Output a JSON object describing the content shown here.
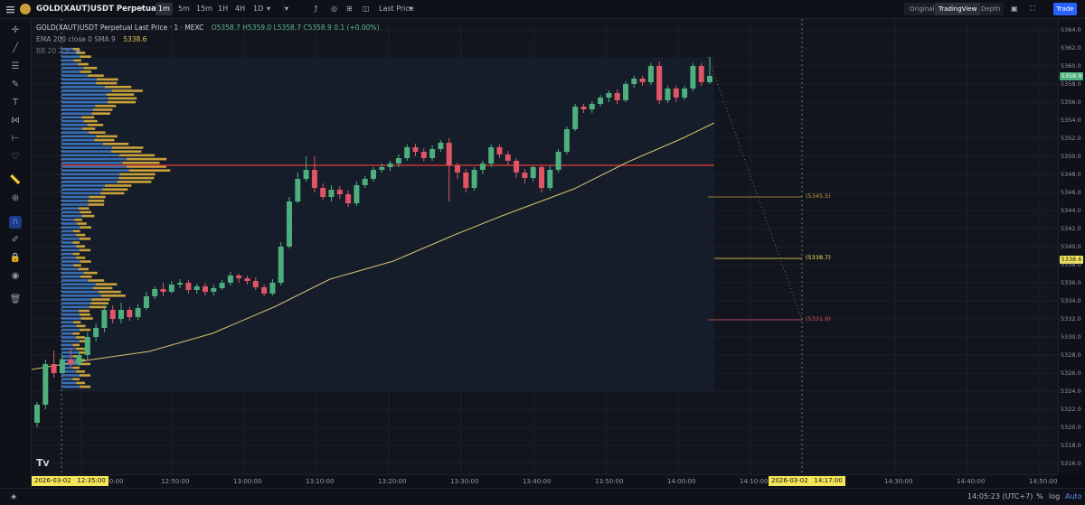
{
  "symbol": {
    "name": "GOLD(XAUT)USDT Perpetual"
  },
  "timeframes": [
    "1m",
    "5m",
    "15m",
    "1H",
    "4H",
    "1D"
  ],
  "active_timeframe": "1m",
  "price_type": "Last Price",
  "view_modes": [
    "Original",
    "TradingView",
    "Depth"
  ],
  "active_view_mode": "TradingView",
  "trade_label": "Trade",
  "legend": {
    "title": "GOLD(XAUT)USDT Perpetual Last Price · 1 · MEXC",
    "ohlc": "O5358.7 H5359.0 L5358.7 C5358.9 0.1 (+0.00%)",
    "ema_label": "EMA 200 close 0 SMA 9",
    "ema_value": "5338.6",
    "bb_label": "BB 20 2 S"
  },
  "y_axis": {
    "ticks": [
      "5364.0",
      "5362.0",
      "5360.0",
      "5358.0",
      "5356.0",
      "5354.0",
      "5352.0",
      "5350.0",
      "5348.0",
      "5346.0",
      "5344.0",
      "5342.0",
      "5340.0",
      "5338.0",
      "5336.0",
      "5334.0",
      "5332.0",
      "5330.0",
      "5328.0",
      "5326.0",
      "5324.0",
      "5322.0",
      "5320.0",
      "5318.0",
      "5316.0"
    ],
    "current_price_tag": "5358.9",
    "ema_tag": "5338.6"
  },
  "x_axis": {
    "ticks": [
      "12:40:00",
      "12:50:00",
      "13:00:00",
      "13:10:00",
      "13:20:00",
      "13:30:00",
      "13:40:00",
      "13:50:00",
      "14:00:00",
      "14:10:00",
      "14:30:00",
      "14:40:00",
      "14:50:00"
    ],
    "crosshair_left_date": "2026-03-02",
    "crosshair_left_time": "12:35:00",
    "crosshair_right_date": "2026-03-02",
    "crosshair_right_time": "14:17:00"
  },
  "levels": {
    "upper": "(5345.5)",
    "middle": "(5338.7)",
    "lower": "(5331.9)"
  },
  "bottom": {
    "time": "14:05:23 (UTC+7)",
    "percent_label": "%",
    "log_label": "log",
    "auto_label": "Auto"
  },
  "colors": {
    "up": "#4caf7d",
    "down": "#e05566",
    "ema": "#d4c46a",
    "poc": "#e53935",
    "vp_blue": "#3b6fb5",
    "vp_gold": "#c9a13b"
  },
  "icons": [
    "crosshair-icon",
    "trend-line-icon",
    "horizontal-lines-icon",
    "brush-icon",
    "text-icon",
    "pattern-icon",
    "forecast-icon",
    "heart-icon",
    "ruler-icon",
    "zoom-icon",
    "magnet-icon",
    "lock-drawings-icon",
    "lock-icon",
    "eye-icon",
    "trash-icon"
  ],
  "chart_data": {
    "type": "candlestick",
    "ylim": [
      5315,
      5365
    ],
    "candles": [
      [
        5320.5,
        5322.5,
        5320,
        5322.8
      ],
      [
        5322.5,
        5327,
        5322,
        5327.5
      ],
      [
        5327,
        5326,
        5325.5,
        5328.5
      ],
      [
        5326,
        5327.5,
        5325.8,
        5328
      ],
      [
        5327.5,
        5327,
        5326.5,
        5328.8
      ],
      [
        5327,
        5328,
        5326.8,
        5328.4
      ],
      [
        5328,
        5330,
        5327.5,
        5330.5
      ],
      [
        5330,
        5331,
        5329.5,
        5331.5
      ],
      [
        5331,
        5333,
        5330.5,
        5333.5
      ],
      [
        5333,
        5332,
        5331.5,
        5333.5
      ],
      [
        5332,
        5333,
        5331.5,
        5333.8
      ],
      [
        5333,
        5332.2,
        5331.8,
        5333.3
      ],
      [
        5332.2,
        5333.2,
        5331.9,
        5333.6
      ],
      [
        5333.2,
        5334.5,
        5333,
        5335
      ],
      [
        5334.5,
        5335.3,
        5334.2,
        5335.6
      ],
      [
        5335.3,
        5335,
        5334.5,
        5336
      ],
      [
        5335,
        5335.8,
        5334.8,
        5336.2
      ],
      [
        5335.8,
        5336,
        5335.4,
        5336.4
      ],
      [
        5336,
        5335.2,
        5334.8,
        5336.3
      ],
      [
        5335.2,
        5335.6,
        5334.8,
        5335.9
      ],
      [
        5335.6,
        5335,
        5334.6,
        5336
      ],
      [
        5335,
        5335.4,
        5334.6,
        5335.8
      ],
      [
        5335.4,
        5336,
        5335.2,
        5336.3
      ],
      [
        5336,
        5336.8,
        5335.7,
        5337.2
      ],
      [
        5336.8,
        5336.5,
        5336,
        5337
      ],
      [
        5336.5,
        5336.2,
        5335.8,
        5336.8
      ],
      [
        5336.2,
        5335.5,
        5335.2,
        5336.6
      ],
      [
        5335.5,
        5334.8,
        5334.5,
        5335.8
      ],
      [
        5334.8,
        5336,
        5334.6,
        5336.4
      ],
      [
        5336,
        5340,
        5335.7,
        5340.5
      ],
      [
        5340,
        5345,
        5339.8,
        5345.5
      ],
      [
        5345,
        5347.5,
        5344.8,
        5348.2
      ],
      [
        5347.5,
        5348.5,
        5347.2,
        5350
      ],
      [
        5348.5,
        5346.5,
        5346,
        5350
      ],
      [
        5346.5,
        5345.5,
        5345.2,
        5347
      ],
      [
        5345.5,
        5346.3,
        5345,
        5346.8
      ],
      [
        5346.3,
        5345.8,
        5345.3,
        5346.7
      ],
      [
        5345.8,
        5344.8,
        5344.4,
        5346.2
      ],
      [
        5344.8,
        5346.8,
        5344.5,
        5347.2
      ],
      [
        5346.8,
        5347.5,
        5346.5,
        5347.8
      ],
      [
        5347.5,
        5348.5,
        5347.2,
        5348.8
      ],
      [
        5348.5,
        5348.8,
        5348.2,
        5349.2
      ],
      [
        5348.8,
        5349.2,
        5348.4,
        5349.5
      ],
      [
        5349.2,
        5349.8,
        5348.8,
        5350.2
      ],
      [
        5349.8,
        5351,
        5349.5,
        5351.3
      ],
      [
        5351,
        5350.5,
        5350,
        5351.4
      ],
      [
        5350.5,
        5349.8,
        5349.4,
        5350.9
      ],
      [
        5349.8,
        5350.8,
        5349.5,
        5351.2
      ],
      [
        5350.8,
        5351.5,
        5350.5,
        5351.8
      ],
      [
        5351.5,
        5349,
        5345,
        5352
      ],
      [
        5349,
        5348.2,
        5347.5,
        5349.3
      ],
      [
        5348.2,
        5346.5,
        5346,
        5348.6
      ],
      [
        5346.5,
        5348.5,
        5346.2,
        5348.8
      ],
      [
        5348.5,
        5349.2,
        5348,
        5349.5
      ],
      [
        5349.2,
        5351,
        5348.8,
        5351.3
      ],
      [
        5351,
        5350.2,
        5349.8,
        5351.3
      ],
      [
        5350.2,
        5349.5,
        5349,
        5350.6
      ],
      [
        5349.5,
        5348.2,
        5347.6,
        5349.8
      ],
      [
        5348.2,
        5347.6,
        5347,
        5348.6
      ],
      [
        5347.6,
        5348.8,
        5347.2,
        5349
      ],
      [
        5348.8,
        5346.5,
        5346,
        5349
      ],
      [
        5346.5,
        5348.5,
        5346.2,
        5349
      ],
      [
        5348.5,
        5350.5,
        5348.2,
        5350.8
      ],
      [
        5350.5,
        5353,
        5350.2,
        5353.3
      ],
      [
        5353,
        5355.5,
        5352.8,
        5355.8
      ],
      [
        5355.5,
        5355.2,
        5354.8,
        5355.8
      ],
      [
        5355.2,
        5355.8,
        5354.8,
        5356.1
      ],
      [
        5355.8,
        5356.5,
        5355.5,
        5356.8
      ],
      [
        5356.5,
        5357,
        5356,
        5357.3
      ],
      [
        5357,
        5356.2,
        5355.8,
        5357.4
      ],
      [
        5356.2,
        5358,
        5356,
        5358.3
      ],
      [
        5358,
        5358.6,
        5357.6,
        5358.9
      ],
      [
        5358.6,
        5358.2,
        5357.8,
        5358.9
      ],
      [
        5358.2,
        5360,
        5357.9,
        5360.3
      ],
      [
        5360,
        5356.2,
        5355.8,
        5360.5
      ],
      [
        5356.2,
        5357.5,
        5355.9,
        5357.8
      ],
      [
        5357.5,
        5356.5,
        5356,
        5357.8
      ],
      [
        5356.5,
        5357.5,
        5356.2,
        5357.8
      ],
      [
        5357.5,
        5360,
        5357.2,
        5360.3
      ],
      [
        5360,
        5358.2,
        5357.8,
        5360.3
      ],
      [
        5358.2,
        5358.9,
        5358,
        5361
      ]
    ],
    "ema200": [
      [
        0,
        5326
      ],
      [
        60,
        5327
      ],
      [
        130,
        5328
      ],
      [
        200,
        5330
      ],
      [
        270,
        5333
      ],
      [
        330,
        5336
      ],
      [
        400,
        5338
      ],
      [
        470,
        5341
      ],
      [
        520,
        5343
      ],
      [
        600,
        5346
      ],
      [
        660,
        5349
      ],
      [
        720,
        5351.6
      ],
      [
        755,
        5353.3
      ]
    ],
    "series": [
      {
        "name": "EMA 200 close 0 SMA 9",
        "value": 5338.6
      }
    ],
    "volume_profile_poc": 5349.0,
    "projection_levels": [
      5345.5,
      5338.7,
      5331.9
    ]
  }
}
